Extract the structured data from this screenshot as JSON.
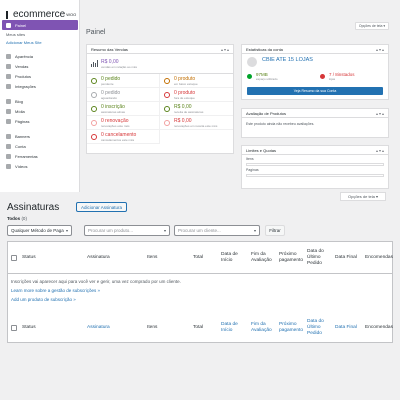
{
  "app": {
    "logo": "ecommerce",
    "logo_sup": "WOO"
  },
  "sidebar": {
    "items": [
      {
        "label": "Painel",
        "active": true
      },
      {
        "label": "Meus sites",
        "sub": true
      },
      {
        "label": "Adicionar Meus Site",
        "sub": true,
        "link": true
      },
      {
        "label": "Aparência"
      },
      {
        "label": "Vendas"
      },
      {
        "label": "Produtos"
      },
      {
        "label": "Integrações"
      },
      {
        "label": "Blog"
      },
      {
        "label": "Mídia"
      },
      {
        "label": "Páginas"
      },
      {
        "label": "Banners"
      },
      {
        "label": "Conta"
      },
      {
        "label": "Ferramentas"
      },
      {
        "label": "Vídeos"
      }
    ]
  },
  "dashboard": {
    "title": "Painel",
    "screen_options": "Opções de tela ▾",
    "status_widget": {
      "title": "Resumo das Vendas",
      "amount": "R$ 0,00",
      "amount_sub": "vendas em relação ao mês",
      "cells": [
        {
          "value": "0 pedido",
          "desc": "pendente",
          "color": "#5b841b",
          "cls": "green"
        },
        {
          "value": "0 produto",
          "desc": "em baixo estoque",
          "color": "#c26e00",
          "cls": "orange"
        },
        {
          "value": "0 pedido",
          "desc": "aguardando",
          "color": "#a7aaad",
          "cls": "gray"
        },
        {
          "value": "0 produto",
          "desc": "fora de estoque",
          "color": "#d63638",
          "cls": "red"
        },
        {
          "value": "0 inscrição",
          "desc": "assinaturas ativas",
          "color": "#5b841b",
          "cls": "green"
        },
        {
          "value": "R$ 0,00",
          "desc": "receita de assinaturas",
          "color": "#5b841b",
          "cls": "green"
        },
        {
          "value": "0 renovação",
          "desc": "renovações este mês",
          "color": "#f2a0a0",
          "cls": "red"
        },
        {
          "value": "R$ 0,00",
          "desc": "renovações em receita este mês",
          "color": "#f2a0a0",
          "cls": "red"
        },
        {
          "value": "0 cancelamento",
          "desc": "cancelamentos este mês",
          "color": "#d63638",
          "cls": "red"
        }
      ]
    },
    "store_widget": {
      "title": "Estatísticas da conta",
      "store_name": "CBIE ATE 15 LOJAS",
      "storage_value": "97MB",
      "storage_sub": "espaço utilizado",
      "stores_value": "7 / 8instados",
      "stores_sub": "lojas",
      "button": "Veja Resumo da sua Conta"
    },
    "reviews_widget": {
      "title": "Avaliação de Produtos",
      "text": "Este produto ainda não recebeu avaliações."
    },
    "stock_widget": {
      "title": "Limites e Quotas",
      "line1": "Itens",
      "line2": "Paginas"
    }
  },
  "subscriptions": {
    "screen_options": "Opções de tela ▾",
    "title": "Assinaturas",
    "add_button": "Adicionar Assinatura",
    "filter_all": "Todos",
    "filter_count": "(0)",
    "method_select": "Qualquer Método de Paga",
    "product_placeholder": "Procurar um produto...",
    "customer_placeholder": "Procurar um cliente...",
    "filter_button": "Filtrar",
    "columns": [
      {
        "label": "Status",
        "link": false
      },
      {
        "label": "Assinatura",
        "link": false
      },
      {
        "label": "Itens",
        "link": false
      },
      {
        "label": "Total",
        "link": false
      },
      {
        "label": "Data de Início",
        "link": false
      },
      {
        "label": "Fim da Avaliação",
        "link": false
      },
      {
        "label": "Próximo pagamento",
        "link": false
      },
      {
        "label": "Data do Último Pedido",
        "link": false
      },
      {
        "label": "Data Final",
        "link": false
      },
      {
        "label": "Encomendas",
        "link": false
      }
    ],
    "footer_columns": [
      {
        "label": "Status",
        "link": false
      },
      {
        "label": "Assinatura",
        "link": true
      },
      {
        "label": "Itens",
        "link": false
      },
      {
        "label": "Total",
        "link": false
      },
      {
        "label": "Data de Início",
        "link": true
      },
      {
        "label": "Fim da Avaliação",
        "link": true
      },
      {
        "label": "Próximo pagamento",
        "link": true
      },
      {
        "label": "Data do Último Pedido",
        "link": true
      },
      {
        "label": "Data Final",
        "link": true
      },
      {
        "label": "Encomendas",
        "link": false
      }
    ],
    "empty_text": "Inscrições vai aparecer aqui para você ver e gerir, uma vez comprado por um cliente.",
    "learn_more": "Learn more sobre a gestão de subscrições »",
    "add_product": "Add um produto de subscrição »"
  }
}
